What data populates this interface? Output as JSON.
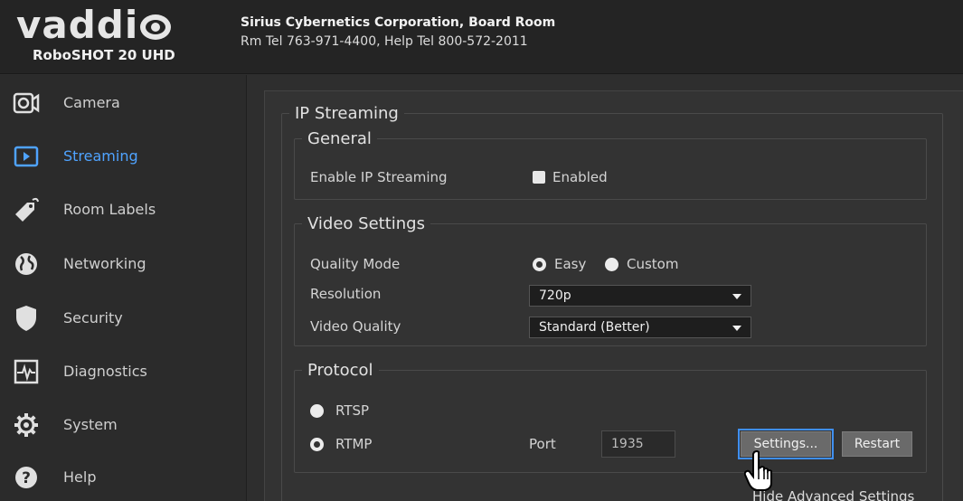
{
  "header": {
    "logo_text": "vaddi",
    "model": "RoboSHOT 20 UHD",
    "room_title": "Sirius Cybernetics Corporation, Board Room",
    "room_phone": "Rm Tel 763-971-4400, Help Tel 800-572-2011"
  },
  "sidebar": {
    "items": [
      {
        "label": "Camera",
        "icon": "camera-icon"
      },
      {
        "label": "Streaming",
        "icon": "play-icon",
        "active": true
      },
      {
        "label": "Room Labels",
        "icon": "tag-icon"
      },
      {
        "label": "Networking",
        "icon": "globe-icon"
      },
      {
        "label": "Security",
        "icon": "shield-icon"
      },
      {
        "label": "Diagnostics",
        "icon": "pulse-icon"
      },
      {
        "label": "System",
        "icon": "gear-icon"
      },
      {
        "label": "Help",
        "icon": "help-icon"
      }
    ]
  },
  "main": {
    "ip_streaming": {
      "title": "IP Streaming",
      "general": {
        "title": "General",
        "enable_label": "Enable IP Streaming",
        "enabled_text": "Enabled",
        "enabled": true
      },
      "video": {
        "title": "Video Settings",
        "quality_mode_label": "Quality Mode",
        "easy_label": "Easy",
        "custom_label": "Custom",
        "quality_mode": "Easy",
        "resolution_label": "Resolution",
        "resolution_value": "720p",
        "video_quality_label": "Video Quality",
        "video_quality_value": "Standard (Better)"
      },
      "protocol": {
        "title": "Protocol",
        "rtsp_label": "RTSP",
        "rtmp_label": "RTMP",
        "selected": "RTMP",
        "port_label": "Port",
        "port_value": "1935",
        "settings_button": "Settings...",
        "restart_button": "Restart"
      },
      "advanced_link": "Hide Advanced Settings"
    }
  },
  "colors": {
    "accent": "#4fa3ff",
    "background": "#2e2e2e",
    "header": "#242424"
  }
}
